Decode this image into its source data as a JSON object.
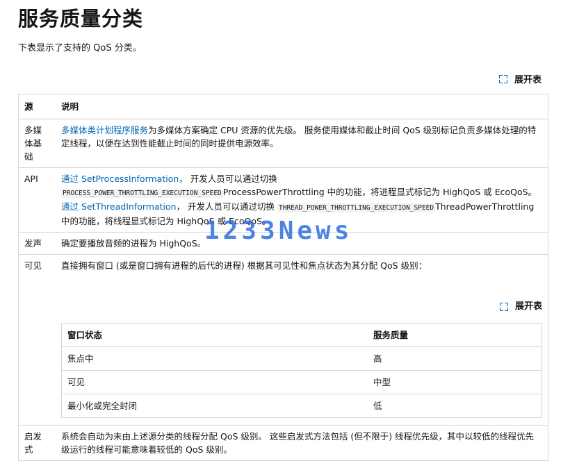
{
  "title": "服务质量分类",
  "intro": "下表显示了支持的 QoS 分类。",
  "expand_label": "展开表",
  "table": {
    "headers": [
      "源",
      "说明"
    ],
    "rows": {
      "multimedia": {
        "source": "多媒体基础",
        "link": "多媒体类计划程序服务",
        "text": "为多媒体方案确定 CPU 资源的优先级。 服务使用媒体和截止时间 QoS 级别标记负责多媒体处理的特定线程，以便在达到性能截止时间的同时提供电源效率。"
      },
      "api": {
        "source": "API",
        "link1": "通过 SetProcessInformation",
        "text1": "， 开发人员可以通过切换",
        "code1": "PROCESS_POWER_THROTTLING_EXECUTION_SPEED",
        "text2": "ProcessPowerThrottling 中的功能，将进程显式标记为 HighQoS 或 EcoQoS。",
        "link2": "通过 SetThreadInformation",
        "text3": "， 开发人员可以通过切换",
        "code2": "THREAD_POWER_THROTTLING_EXECUTION_SPEED",
        "text4": "ThreadPowerThrottling 中的功能，将线程显式标记为 HighQoS 或 EcoQoS。"
      },
      "audio": {
        "source": "发声",
        "text": "确定要播放音频的进程为 HighQoS。"
      },
      "visible": {
        "source": "可见",
        "text": "直接拥有窗口 (或是窗口拥有进程的后代的进程) 根据其可见性和焦点状态为其分配 QoS 级别：",
        "inner_headers": [
          "窗口状态",
          "服务质量"
        ],
        "inner_rows": [
          {
            "state": "焦点中",
            "qos": "高"
          },
          {
            "state": "可见",
            "qos": "中型"
          },
          {
            "state": "最小化或完全封闭",
            "qos": "低"
          }
        ]
      },
      "heuristic": {
        "source": "启发式",
        "text": "系统会自动为未由上述源分类的线程分配 QoS 级别。 这些启发式方法包括 (但不限于) 线程优先级，其中以较低的线程优先级运行的线程可能意味着较低的 QoS 级别。"
      }
    }
  },
  "watermark": "1233News"
}
